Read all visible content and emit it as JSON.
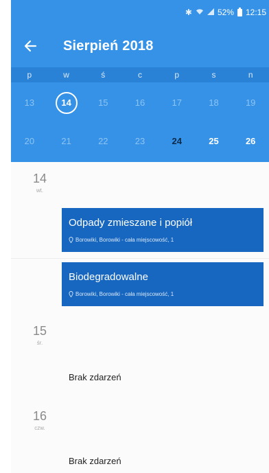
{
  "status_bar": {
    "battery": "52%",
    "time": "12:15",
    "icons": [
      "bluetooth-icon",
      "wifi-icon",
      "signal-icon",
      "battery-icon"
    ]
  },
  "app_bar": {
    "title": "Sierpień 2018",
    "back_icon": "arrow-left-icon"
  },
  "calendar": {
    "weekdays": [
      "p",
      "w",
      "ś",
      "c",
      "p",
      "s",
      "n"
    ],
    "week1": [
      "13",
      "14",
      "15",
      "16",
      "17",
      "18",
      "19"
    ],
    "week2": [
      "20",
      "21",
      "22",
      "23",
      "24",
      "25",
      "26"
    ],
    "selected_day": "14",
    "today": "24"
  },
  "agenda": {
    "days": [
      {
        "num": "14",
        "dow": "wt.",
        "events": [
          {
            "title": "Odpady zmieszane i popiół",
            "location": "Borowiki, Borowiki - cała miejscowość, 1"
          },
          {
            "title": "Biodegradowalne",
            "location": "Borowiki, Borowiki - cała miejscowość, 1"
          }
        ]
      },
      {
        "num": "15",
        "dow": "śr.",
        "empty_text": "Brak zdarzeń"
      },
      {
        "num": "16",
        "dow": "czw.",
        "empty_text": "Brak zdarzeń"
      }
    ]
  },
  "colors": {
    "primary": "#3592e6",
    "weekday_bar": "#2a82d6",
    "event_card": "#1767c0",
    "today_text": "#0d2a4b"
  }
}
